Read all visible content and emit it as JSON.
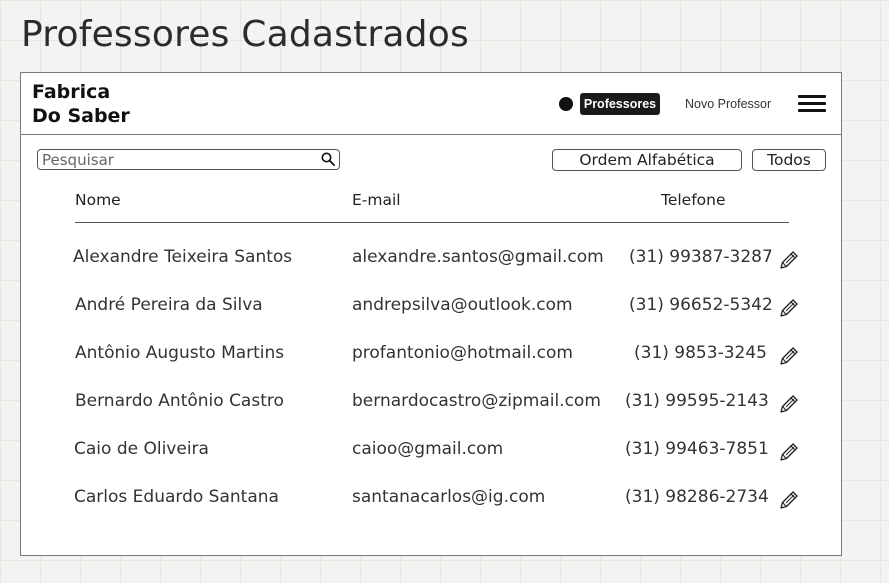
{
  "page": {
    "title": "Professores Cadastrados"
  },
  "header": {
    "logo_line1": "Fabrica",
    "logo_line2": "Do Saber",
    "nav_active": "Professores",
    "nav_new": "Novo Professor",
    "menu_icon": "hamburger-menu-icon"
  },
  "toolbar": {
    "search_placeholder": "Pesquisar",
    "search_value": "",
    "search_icon": "search-icon",
    "sort_label": "Ordem Alfabética",
    "filter_all_label": "Todos"
  },
  "table": {
    "headers": {
      "name": "Nome",
      "email": "E-mail",
      "phone": "Telefone"
    },
    "edit_icon": "pencil-edit-icon",
    "rows": [
      {
        "name": "Alexandre Teixeira Santos",
        "email": "alexandre.santos@gmail.com",
        "phone": "(31) 99387-3287"
      },
      {
        "name": "André Pereira da Silva",
        "email": "andrepsilva@outlook.com",
        "phone": "(31) 96652-5342"
      },
      {
        "name": "Antônio Augusto Martins",
        "email": "profantonio@hotmail.com",
        "phone": "(31) 9853-3245"
      },
      {
        "name": "Bernardo Antônio Castro",
        "email": "bernardocastro@zipmail.com",
        "phone": "(31) 99595-2143"
      },
      {
        "name": "Caio de Oliveira",
        "email": "caioo@gmail.com",
        "phone": "(31) 99463-7851"
      },
      {
        "name": "Carlos Eduardo Santana",
        "email": "santanacarlos@ig.com",
        "phone": "(31) 98286-2734"
      }
    ]
  },
  "colors": {
    "canvas": "#f3f3f1",
    "grid": "#e6e6e3",
    "frame_border": "#7a7a7a",
    "active_nav_bg": "#1a1a1a",
    "text": "#333333"
  }
}
